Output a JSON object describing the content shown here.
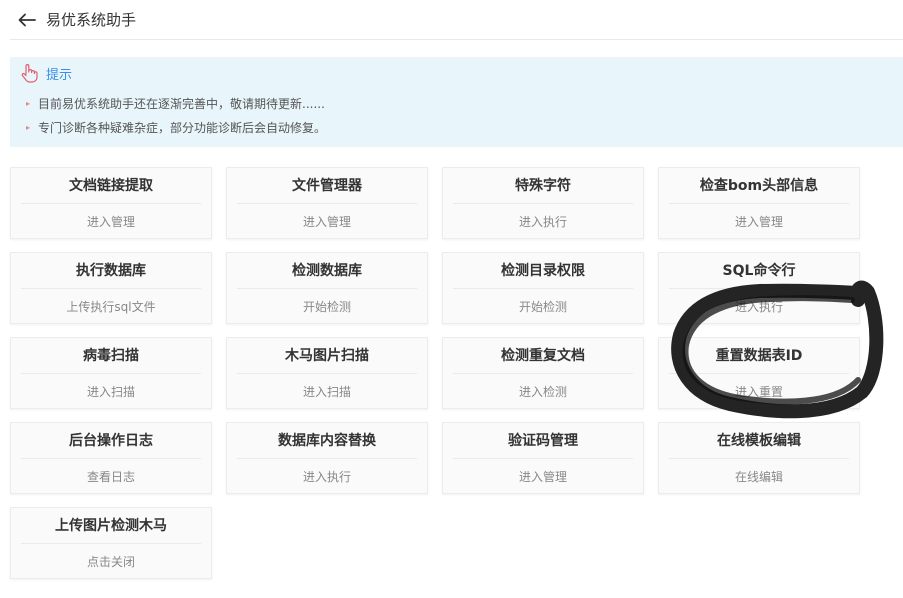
{
  "header": {
    "title": "易优系统助手"
  },
  "tips": {
    "title": "提示",
    "items": [
      "目前易优系统助手还在逐渐完善中，敬请期待更新......",
      "专门诊断各种疑难杂症，部分功能诊断后会自动修复。"
    ]
  },
  "tools": [
    {
      "title": "文档链接提取",
      "action": "进入管理"
    },
    {
      "title": "文件管理器",
      "action": "进入管理"
    },
    {
      "title": "特殊字符",
      "action": "进入执行"
    },
    {
      "title": "检查bom头部信息",
      "action": "进入管理"
    },
    {
      "title": "执行数据库",
      "action": "上传执行sql文件"
    },
    {
      "title": "检测数据库",
      "action": "开始检测"
    },
    {
      "title": "检测目录权限",
      "action": "开始检测"
    },
    {
      "title": "SQL命令行",
      "action": "进入执行"
    },
    {
      "title": "病毒扫描",
      "action": "进入扫描"
    },
    {
      "title": "木马图片扫描",
      "action": "进入扫描"
    },
    {
      "title": "检测重复文档",
      "action": "进入检测"
    },
    {
      "title": "重置数据表ID",
      "action": "进入重置"
    },
    {
      "title": "后台操作日志",
      "action": "查看日志"
    },
    {
      "title": "数据库内容替换",
      "action": "进入执行"
    },
    {
      "title": "验证码管理",
      "action": "进入管理"
    },
    {
      "title": "在线模板编辑",
      "action": "在线编辑"
    },
    {
      "title": "上传图片检测木马",
      "action": "点击关闭"
    }
  ],
  "colors": {
    "tip_background": "#e8f5fb",
    "tip_title": "#3a8ee6",
    "card_background": "#fafafa",
    "annotation": "#111111"
  },
  "icons": {
    "back": "arrow-left-icon",
    "tip": "hand-pointer-icon"
  }
}
